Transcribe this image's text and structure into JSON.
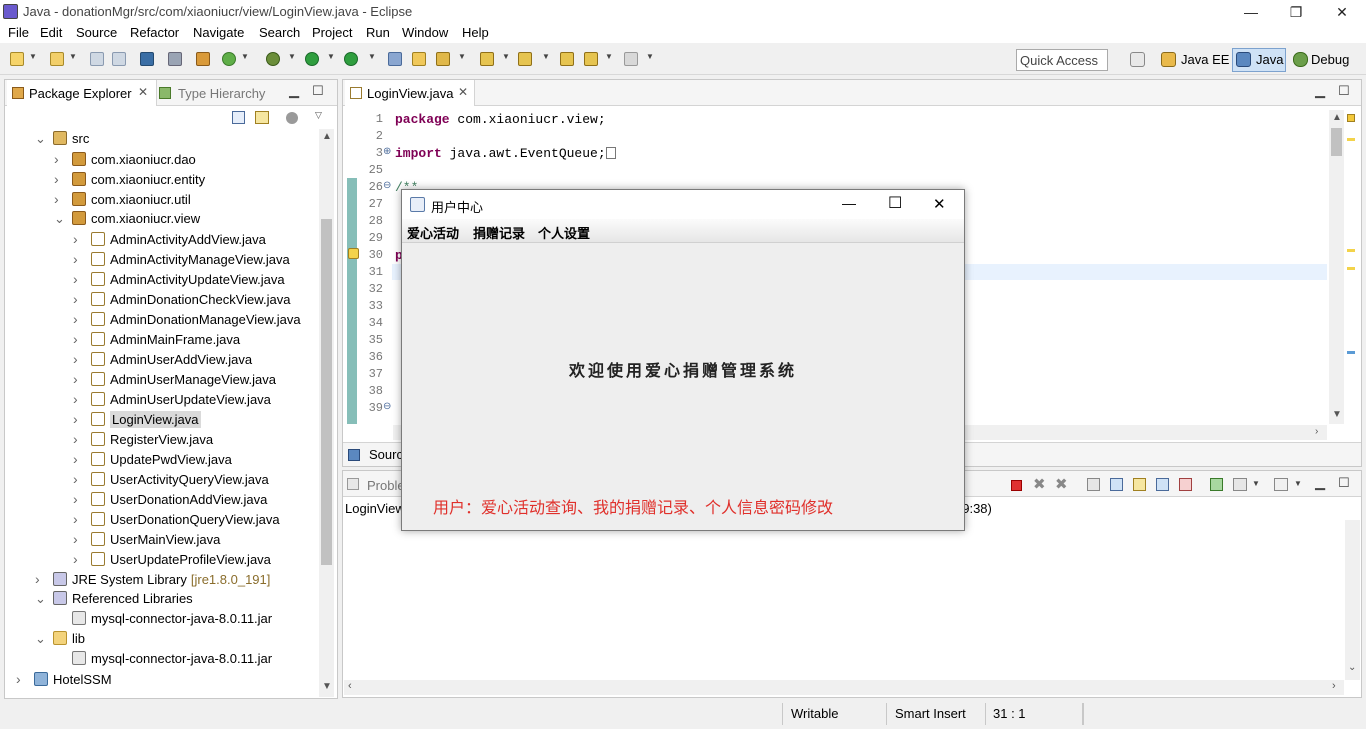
{
  "window": {
    "title": "Java - donationMgr/src/com/xiaoniucr/view/LoginView.java - Eclipse",
    "minimize": "—",
    "restore": "❐",
    "close": "✕"
  },
  "menu": [
    "File",
    "Edit",
    "Source",
    "Refactor",
    "Navigate",
    "Search",
    "Project",
    "Run",
    "Window",
    "Help"
  ],
  "toolbar": {
    "quick_access": "Quick Access",
    "perspectives": [
      "Java EE",
      "Java",
      "Debug"
    ]
  },
  "package_explorer": {
    "tab_label": "Package Explorer",
    "tab2_label": "Type Hierarchy",
    "tree": [
      {
        "label": "src",
        "indent": 1,
        "icon": "src",
        "open": true
      },
      {
        "label": "com.xiaoniucr.dao",
        "indent": 2,
        "icon": "pkg",
        "open": false
      },
      {
        "label": "com.xiaoniucr.entity",
        "indent": 2,
        "icon": "pkg",
        "open": false
      },
      {
        "label": "com.xiaoniucr.util",
        "indent": 2,
        "icon": "pkg",
        "open": false
      },
      {
        "label": "com.xiaoniucr.view",
        "indent": 2,
        "icon": "pkg",
        "open": true
      },
      {
        "label": "AdminActivityAddView.java",
        "indent": 3,
        "icon": "java",
        "open": false
      },
      {
        "label": "AdminActivityManageView.java",
        "indent": 3,
        "icon": "java",
        "open": false
      },
      {
        "label": "AdminActivityUpdateView.java",
        "indent": 3,
        "icon": "java",
        "open": false
      },
      {
        "label": "AdminDonationCheckView.java",
        "indent": 3,
        "icon": "java",
        "open": false
      },
      {
        "label": "AdminDonationManageView.java",
        "indent": 3,
        "icon": "java",
        "open": false
      },
      {
        "label": "AdminMainFrame.java",
        "indent": 3,
        "icon": "java",
        "open": false
      },
      {
        "label": "AdminUserAddView.java",
        "indent": 3,
        "icon": "java",
        "open": false
      },
      {
        "label": "AdminUserManageView.java",
        "indent": 3,
        "icon": "java",
        "open": false
      },
      {
        "label": "AdminUserUpdateView.java",
        "indent": 3,
        "icon": "java",
        "open": false
      },
      {
        "label": "LoginView.java",
        "indent": 3,
        "icon": "java",
        "open": false,
        "selected": true
      },
      {
        "label": "RegisterView.java",
        "indent": 3,
        "icon": "java",
        "open": false
      },
      {
        "label": "UpdatePwdView.java",
        "indent": 3,
        "icon": "java",
        "open": false
      },
      {
        "label": "UserActivityQueryView.java",
        "indent": 3,
        "icon": "java",
        "open": false
      },
      {
        "label": "UserDonationAddView.java",
        "indent": 3,
        "icon": "java",
        "open": false
      },
      {
        "label": "UserDonationQueryView.java",
        "indent": 3,
        "icon": "java",
        "open": false
      },
      {
        "label": "UserMainView.java",
        "indent": 3,
        "icon": "java",
        "open": false
      },
      {
        "label": "UserUpdateProfileView.java",
        "indent": 3,
        "icon": "java",
        "open": false
      },
      {
        "label": "JRE System Library",
        "suffix": "[jre1.8.0_191]",
        "indent": 1,
        "icon": "lib",
        "open": false
      },
      {
        "label": "Referenced Libraries",
        "indent": 1,
        "icon": "lib",
        "open": true
      },
      {
        "label": "mysql-connector-java-8.0.11.jar",
        "indent": 2,
        "icon": "jar",
        "noTwisty": true
      },
      {
        "label": "lib",
        "indent": 1,
        "icon": "folder",
        "open": true
      },
      {
        "label": "mysql-connector-java-8.0.11.jar",
        "indent": 2,
        "icon": "jar",
        "noTwisty": true
      },
      {
        "label": "HotelSSM",
        "indent": 0,
        "icon": "proj",
        "open": false
      }
    ]
  },
  "editor": {
    "tab_label": "LoginView.java",
    "source_tab": "Sourc",
    "line_numbers": [
      "1",
      "2",
      "3",
      "25",
      "26",
      "27",
      "28",
      "29",
      "30",
      "31",
      "32",
      "33",
      "34",
      "35",
      "36",
      "37",
      "38",
      "39"
    ],
    "code": {
      "line1_kw": "package",
      "line1_rest": " com.xiaoniucr.view;",
      "line3_kw": "import",
      "line3_rest": " java.awt.EventQueue;",
      "line26": "/**",
      "line30": "p"
    }
  },
  "bottom_panel": {
    "tab_label": "Proble",
    "console_line_start": "LoginView",
    "console_line_end": "39:38)"
  },
  "status": {
    "writable": "Writable",
    "insert_mode": "Smart Insert",
    "position": "31 : 1"
  },
  "dialog": {
    "title": "用户中心",
    "menu": [
      "爱心活动",
      "捐赠记录",
      "个人设置"
    ],
    "welcome": "欢迎使用爱心捐赠管理系统",
    "user_desc": "用户：爱心活动查询、我的捐赠记录、个人信息密码修改",
    "minimize": "—",
    "maximize": "☐",
    "close": "✕"
  },
  "colors": {
    "keyword": "#7f0055",
    "comment": "#3f7f5f",
    "desc_text": "#e0302b",
    "current_line": "#e8f2fe"
  }
}
